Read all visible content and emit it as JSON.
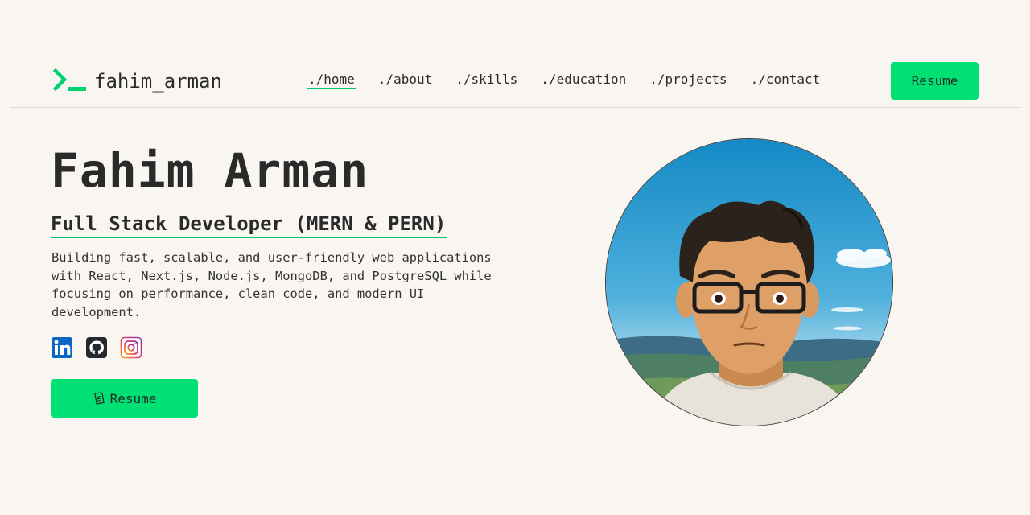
{
  "brand": {
    "name": "fahim_arman",
    "icon": "terminal-prompt-icon",
    "accent_color": "#00e075"
  },
  "nav": {
    "links": [
      "./home",
      "./about",
      "./skills",
      "./education",
      "./projects",
      "./contact"
    ],
    "active": "./home",
    "resume_label": "Resume"
  },
  "hero": {
    "name": "Fahim Arman",
    "role": "Full Stack Developer (MERN & PERN)",
    "description": "Building fast, scalable, and user-friendly web applications with React, Next.js, Node.js, MongoDB, and PostgreSQL while focusing on performance, clean code, and modern UI development.",
    "socials": [
      {
        "name": "linkedin-icon",
        "color": "#0a66c2"
      },
      {
        "name": "github-icon",
        "color": "#24292e"
      },
      {
        "name": "instagram-icon",
        "color": "#e1306c"
      }
    ],
    "resume_button": {
      "label": "Resume",
      "icon": "document-icon"
    }
  },
  "avatar": {
    "description_icon": "avatar-illustration"
  }
}
